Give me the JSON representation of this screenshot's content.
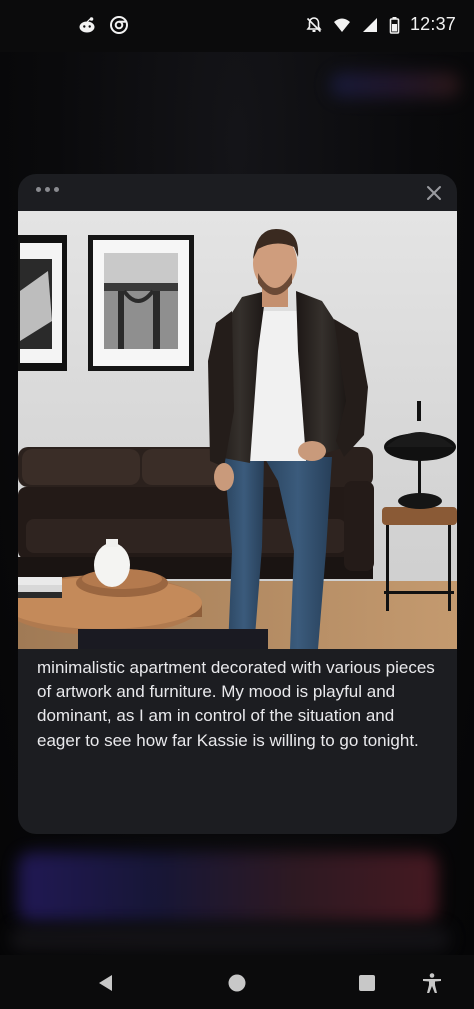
{
  "status_bar": {
    "time": "12:37",
    "left_icons": [
      "reddit-icon",
      "chrome-icon"
    ],
    "right_icons": [
      "notifications-off-icon",
      "wifi-icon",
      "cellular-signal-icon",
      "battery-icon"
    ]
  },
  "modal": {
    "menu_icon": "more-horizontal-icon",
    "close_icon": "close-icon",
    "image": {
      "subject": "man in black leather jacket, white t-shirt and jeans standing in a living room with a leather sofa, framed art and a round wooden coffee table"
    },
    "story_text": "minimalistic apartment decorated with various pieces of artwork and furniture. My mood is playful and dominant, as I am in control of the situation and eager to see how far Kassie is willing to go tonight."
  },
  "nav_bar": {
    "buttons": [
      "back-icon",
      "home-icon",
      "recents-icon",
      "accessibility-icon"
    ]
  },
  "colors": {
    "modal_bg": "#1c1d21",
    "text": "#e9e9ec",
    "backdrop": "#0a0a0c"
  }
}
